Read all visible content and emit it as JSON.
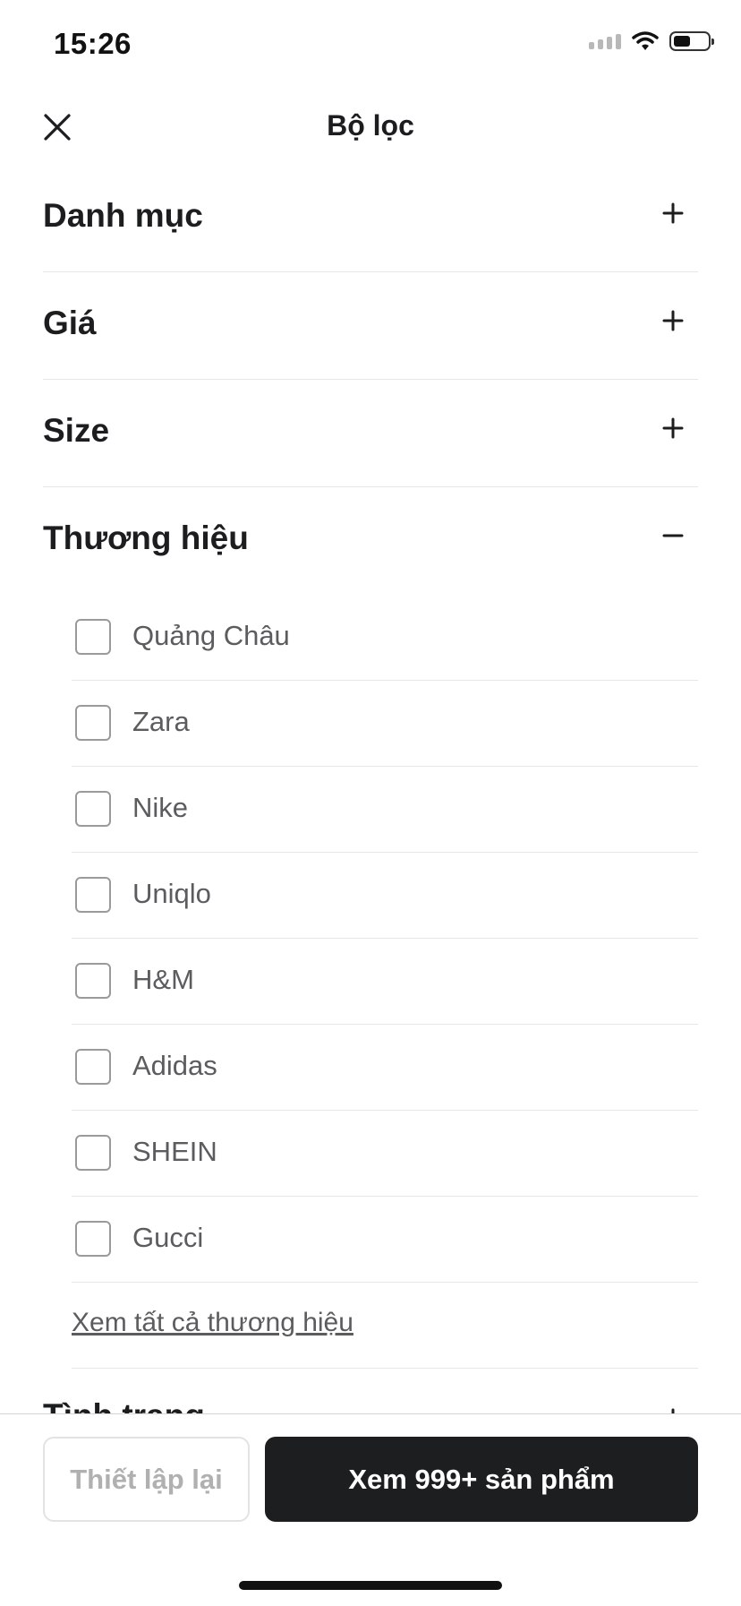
{
  "status": {
    "time": "15:26"
  },
  "header": {
    "title": "Bộ lọc"
  },
  "sections": [
    {
      "label": "Danh mục",
      "toggle": "plus"
    },
    {
      "label": "Giá",
      "toggle": "plus"
    },
    {
      "label": "Size",
      "toggle": "plus"
    },
    {
      "label": "Thương hiệu",
      "toggle": "minus"
    }
  ],
  "brands": [
    {
      "name": "Quảng Châu",
      "checked": false
    },
    {
      "name": "Zara",
      "checked": false
    },
    {
      "name": "Nike",
      "checked": false
    },
    {
      "name": "Uniqlo",
      "checked": false
    },
    {
      "name": "H&M",
      "checked": false
    },
    {
      "name": "Adidas",
      "checked": false
    },
    {
      "name": "SHEIN",
      "checked": false
    },
    {
      "name": "Gucci",
      "checked": false
    }
  ],
  "see_all_label": "Xem tất cả thương hiệu",
  "next_section_label": "Tình trạng",
  "footer": {
    "reset_label": "Thiết lập lại",
    "view_label": "Xem 999+ sản phẩm"
  },
  "colors": {
    "primary_button": "#1d1e20",
    "divider": "#e6e6e6",
    "checkbox_border": "#9a9a9a",
    "muted_text": "#5b5c5e"
  }
}
